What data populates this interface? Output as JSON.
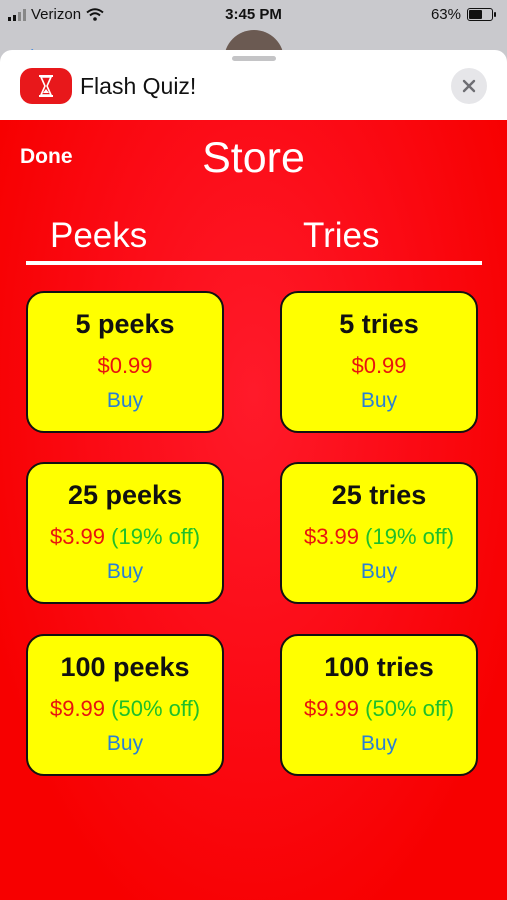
{
  "status_bar": {
    "carrier": "Verizon",
    "time": "3:45 PM",
    "battery_percent": "63%",
    "battery_level": 0.63,
    "wifi_icon": "wifi-icon"
  },
  "app": {
    "title": "Flash Quiz!",
    "icon": "hourglass-icon",
    "close_icon": "close-icon"
  },
  "store": {
    "done_label": "Done",
    "title": "Store",
    "tabs": [
      "Peeks",
      "Tries"
    ],
    "peeks": [
      {
        "qty": "5 peeks",
        "price": "$0.99",
        "discount": "",
        "buy": "Buy"
      },
      {
        "qty": "25 peeks",
        "price": "$3.99",
        "discount": "(19% off)",
        "buy": "Buy"
      },
      {
        "qty": "100 peeks",
        "price": "$9.99",
        "discount": "(50% off)",
        "buy": "Buy"
      }
    ],
    "tries": [
      {
        "qty": "5 tries",
        "price": "$0.99",
        "discount": "",
        "buy": "Buy"
      },
      {
        "qty": "25 tries",
        "price": "$3.99",
        "discount": "(19% off)",
        "buy": "Buy"
      },
      {
        "qty": "100 tries",
        "price": "$9.99",
        "discount": "(50% off)",
        "buy": "Buy"
      }
    ]
  },
  "colors": {
    "background_red": "#f70000",
    "card_yellow": "#ffff00",
    "price_red": "#e8140e",
    "discount_green": "#1fbf2a",
    "buy_blue": "#2a7fd4"
  }
}
